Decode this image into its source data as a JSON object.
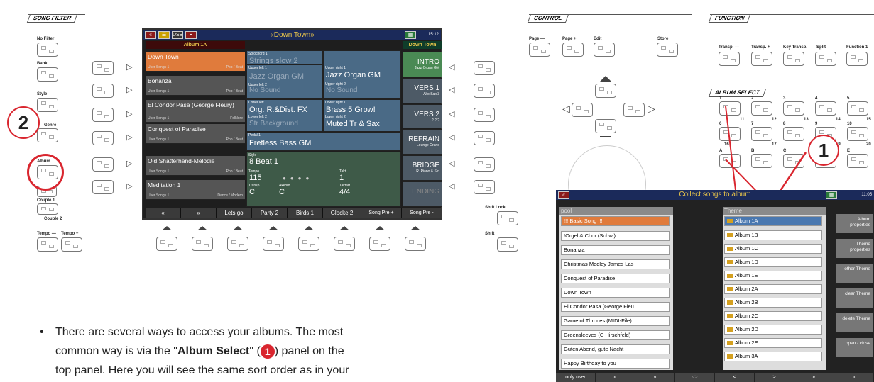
{
  "sections": {
    "song_filter": "SONG FILTER",
    "control": "CONTROL",
    "function": "FUNCTION",
    "album_select": "ALBUM SELECT"
  },
  "left_buttons": {
    "no_filter": "No Filter",
    "bank": "Bank",
    "style": "Style",
    "genre": "Genre",
    "album": "Album",
    "couple1": "Couple 1",
    "couple2": "Couple 2",
    "tempo_minus": "Tempo —",
    "tempo_plus": "Tempo +"
  },
  "right_buttons": {
    "shift_lock": "Shift Lock",
    "shift": "Shift"
  },
  "control_buttons": {
    "page_minus": "Page —",
    "page_plus": "Page +",
    "edit": "Edit",
    "store": "Store"
  },
  "function_buttons": {
    "transp_minus": "Transp. —",
    "transp_plus": "Transp. +",
    "key_transp": "Key Transp.",
    "split": "Split",
    "function1": "Function 1"
  },
  "album_keys": {
    "n1": "1",
    "n2": "2",
    "n3": "3",
    "n4": "4",
    "n5": "5",
    "n6": "6",
    "n7": "7",
    "n8": "8",
    "n9": "9",
    "n10": "10",
    "n11": "11",
    "n12": "12",
    "n13": "13",
    "n14": "14",
    "n15": "15",
    "n16": "16",
    "n17": "17",
    "n18": "18",
    "n19": "19",
    "n20": "20",
    "A": "A",
    "B": "B",
    "C": "C",
    "E": "E"
  },
  "markers": {
    "one": "1",
    "two": "2"
  },
  "screen": {
    "title": "«Down Town»",
    "time": "15:12",
    "album_header": "Album 1A",
    "song_header": "Down Town",
    "icon_usb": "USB",
    "songs": [
      {
        "title": "Down Town",
        "cat": "User Songs 1",
        "genre": "Pop / Beat"
      },
      {
        "title": "Bonanza",
        "cat": "User Songs 1",
        "genre": "Pop / Beat"
      },
      {
        "title": "El Condor Pasa (George Fleury)",
        "cat": "User Songs 1",
        "genre": "Folklore"
      },
      {
        "title": "Conquest of Paradise",
        "cat": "User Songs 1",
        "genre": "Pop / Beat"
      },
      {
        "title": "Old Shatterhand-Melodie",
        "cat": "User Songs 1",
        "genre": "Pop / Beat"
      },
      {
        "title": "Meditation 1",
        "cat": "User Songs 1",
        "genre": "Dance / Modern"
      }
    ],
    "solo_label": "Solochord 1",
    "solo_value": "Strings slow 2",
    "ul1_label": "Upper left 1",
    "ul1_value": "Jazz Organ   GM",
    "ul2_label": "Upper left 2",
    "ul2_value": "No Sound",
    "ur1_label": "Upper right 1",
    "ur1_value": "Jazz Organ   GM",
    "ur2_label": "Upper right 2",
    "ur2_value": "No Sound",
    "ll1_label": "Lower left 1",
    "ll1_value": "Org. R.&Dist. FX",
    "ll2_label": "Lower left 2",
    "ll2_value": "Str Background",
    "lr1_label": "Lower right 1",
    "lr1_value": "Brass 5 Grow!",
    "lr2_label": "Lower right 2",
    "lr2_value": "Muted Tr & Sax",
    "pedal_label": "Pedal 1",
    "pedal_value": "Fretless Bass GM",
    "style_label": "Style",
    "style_value": "8 Beat 1",
    "tempo_label": "Tempo",
    "tempo_value": "115",
    "takt_label": "Takt",
    "takt_value": "1",
    "transp_label": "Transp.",
    "transp_value": "C",
    "akkord_label": "Akkord",
    "akkord_value": "C",
    "taktart_label": "Taktart",
    "taktart_value": "4/4",
    "parts": [
      {
        "name": "INTRO",
        "sub": "Jazz Organ   GM"
      },
      {
        "name": "VERS 1",
        "sub": "Alto Sax 3"
      },
      {
        "name": "VERS 2",
        "sub": "? ? ?"
      },
      {
        "name": "REFRAIN",
        "sub": "Lounge Grand"
      },
      {
        "name": "BRIDGE",
        "sub": "R. Piano & Str."
      },
      {
        "name": "ENDING",
        "sub": ""
      }
    ],
    "bottom": [
      "«",
      "»",
      "Lets go",
      "Party 2",
      "Birds 1",
      "Glocke 2",
      "Song Pre +",
      "Song Pre -"
    ]
  },
  "collect": {
    "title": "Collect songs to album",
    "time": "11:05",
    "pool_header": "pool",
    "theme_header": "Theme",
    "pool": [
      "!!! Basic Song !!!",
      "!Orgel & Chor (Schw.)",
      "Bonanza",
      "Christmas Medley James Las",
      "Conquest of Paradise",
      "Down Town",
      "El Condor Pasa (George Fleu",
      "Game of Thrones (MIDI-File)",
      "Greensleeves (C Hirschfeld)",
      "Guten Abend, gute Nacht",
      "Happy Birthday to you"
    ],
    "albums": [
      "Album 1A",
      "Album 1B",
      "Album 1C",
      "Album 1D",
      "Album 1E",
      "Album 2A",
      "Album 2B",
      "Album 2C",
      "Album 2D",
      "Album 2E",
      "Album 3A"
    ],
    "side": [
      "Album properties",
      "Theme properties",
      "other Theme",
      "clear Theme",
      "delete Theme",
      "open / close"
    ],
    "bottom": [
      "only user",
      "«",
      "»",
      "<>",
      "<",
      ">",
      "«",
      "»"
    ]
  },
  "body_text": {
    "line1": "There are several ways to access your albums. The most",
    "line2a": "common way is via the \"",
    "line2b": "Album Select",
    "line2c": "\" (",
    "line2d": ") panel on the",
    "line3": "top panel. Here you will see the same sort order as in your",
    "badge": "1",
    "bullet": "•"
  }
}
